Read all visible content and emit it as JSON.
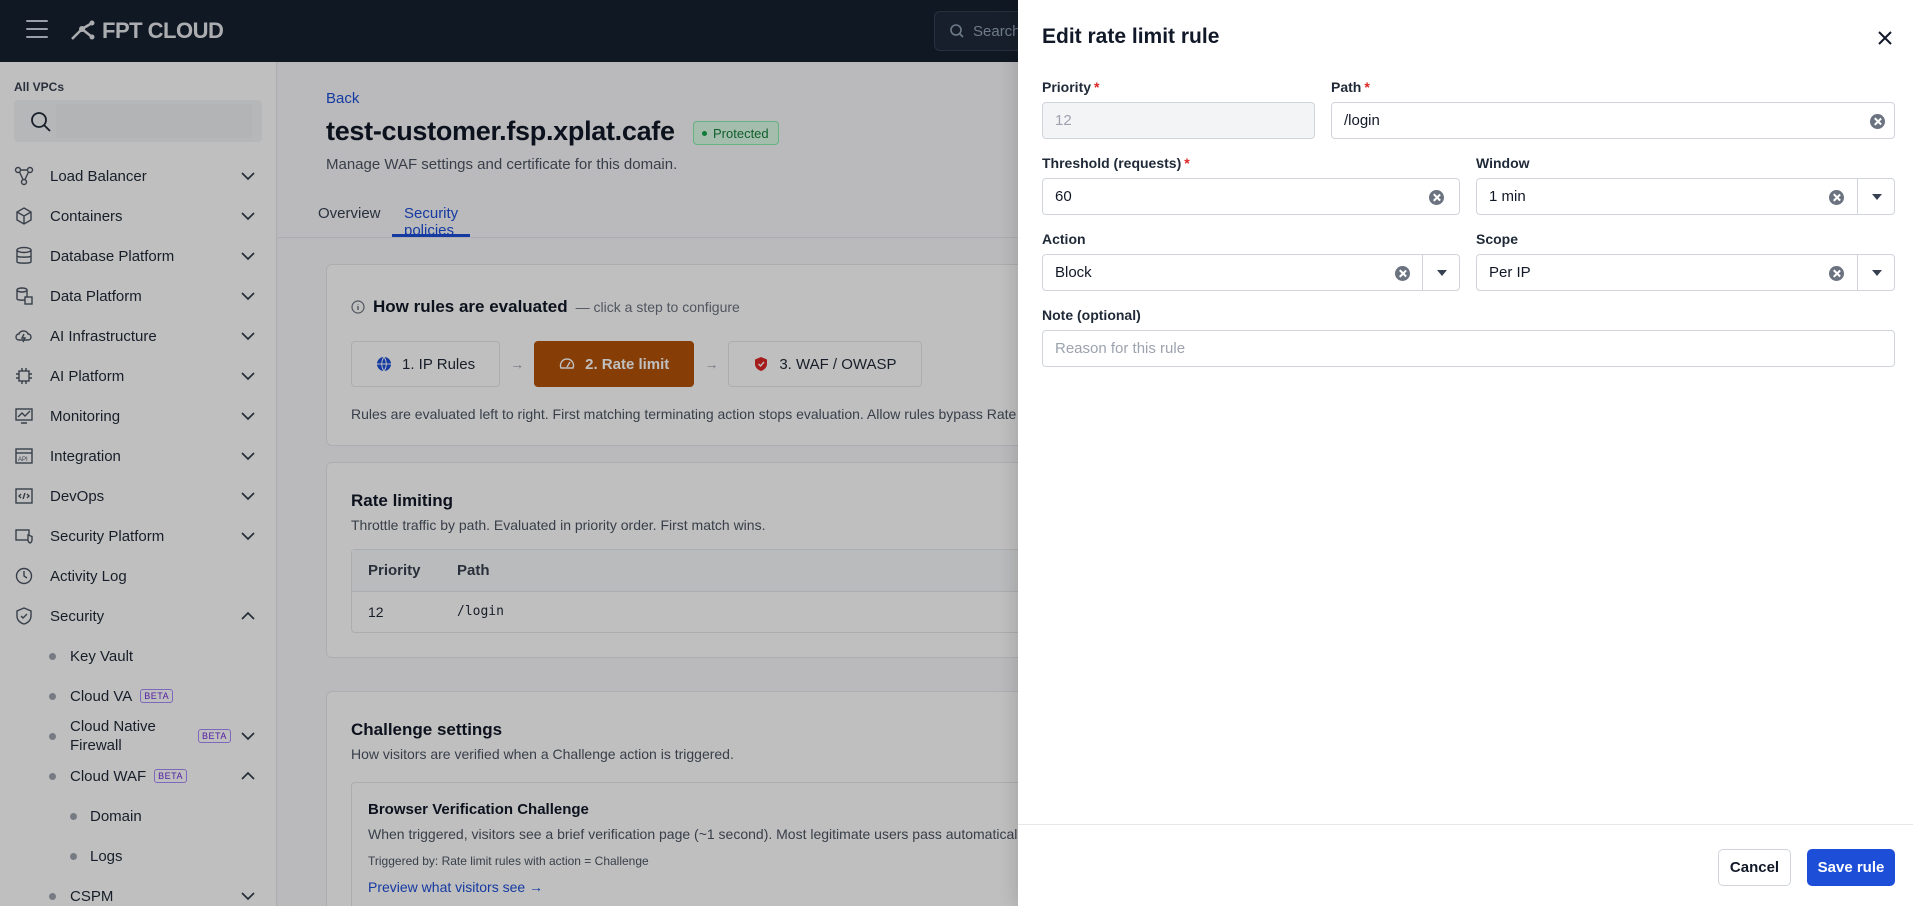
{
  "topbar": {
    "logo_text": "FPT CLOUD",
    "search_placeholder": "Search"
  },
  "sidebar": {
    "vpc_label": "All VPCs",
    "items": [
      {
        "label": "Load Balancer",
        "icon": "load-balancer-icon"
      },
      {
        "label": "Containers",
        "icon": "cube-icon"
      },
      {
        "label": "Database Platform",
        "icon": "database-icon"
      },
      {
        "label": "Data Platform",
        "icon": "data-platform-icon"
      },
      {
        "label": "AI Infrastructure",
        "icon": "cloud-ai-icon"
      },
      {
        "label": "AI Platform",
        "icon": "chip-icon"
      },
      {
        "label": "Monitoring",
        "icon": "monitor-icon"
      },
      {
        "label": "Integration",
        "icon": "api-icon"
      },
      {
        "label": "DevOps",
        "icon": "code-icon"
      },
      {
        "label": "Security Platform",
        "icon": "security-platform-icon"
      },
      {
        "label": "Activity Log",
        "icon": "clock-icon"
      },
      {
        "label": "Security",
        "icon": "shield-icon"
      }
    ],
    "security_children": [
      {
        "label": "Key Vault"
      },
      {
        "label": "Cloud VA",
        "badge": "BETA"
      },
      {
        "label": "Cloud Native Firewall",
        "badge": "BETA"
      },
      {
        "label": "Cloud WAF",
        "badge": "BETA"
      }
    ],
    "waf_children": [
      {
        "label": "Domain"
      },
      {
        "label": "Logs"
      }
    ],
    "cspm": {
      "label": "CSPM"
    }
  },
  "main": {
    "back_label": "Back",
    "title": "test-customer.fsp.xplat.cafe",
    "status_badge": "Protected",
    "subtitle": "Manage WAF settings and certificate for this domain.",
    "tabs": [
      {
        "label": "Overview"
      },
      {
        "label": "Security policies"
      }
    ],
    "eval": {
      "title": "How rules are evaluated",
      "hint": "— click a step to configure",
      "steps": [
        {
          "label": "1. IP Rules"
        },
        {
          "label": "2. Rate limit"
        },
        {
          "label": "3. WAF / OWASP"
        }
      ],
      "note": "Rules are evaluated left to right. First matching terminating action stops evaluation. Allow rules bypass Rate L"
    },
    "rate_limiting": {
      "title": "Rate limiting",
      "subtitle": "Throttle traffic by path. Evaluated in priority order. First match wins.",
      "columns": [
        "Priority",
        "Path"
      ],
      "rows": [
        {
          "priority": "12",
          "path": "/login"
        }
      ]
    },
    "challenge": {
      "title": "Challenge settings",
      "subtitle": "How visitors are verified when a Challenge action is triggered.",
      "box_title": "Browser Verification Challenge",
      "box_desc": "When triggered, visitors see a brief verification page (~1 second). Most legitimate users pass automatically",
      "box_trigger": "Triggered by: Rate limit rules with action = Challenge",
      "preview_link": "Preview what visitors see →"
    }
  },
  "drawer": {
    "title": "Edit rate limit rule",
    "priority": {
      "label": "Priority",
      "value": "12"
    },
    "path": {
      "label": "Path",
      "value": "/login"
    },
    "threshold": {
      "label": "Threshold (requests)",
      "value": "60"
    },
    "window": {
      "label": "Window",
      "value": "1 min"
    },
    "action": {
      "label": "Action",
      "value": "Block"
    },
    "scope": {
      "label": "Scope",
      "value": "Per IP"
    },
    "note": {
      "label": "Note (optional)",
      "placeholder": "Reason for this rule"
    },
    "required_mark": "*",
    "cancel_label": "Cancel",
    "save_label": "Save rule"
  }
}
